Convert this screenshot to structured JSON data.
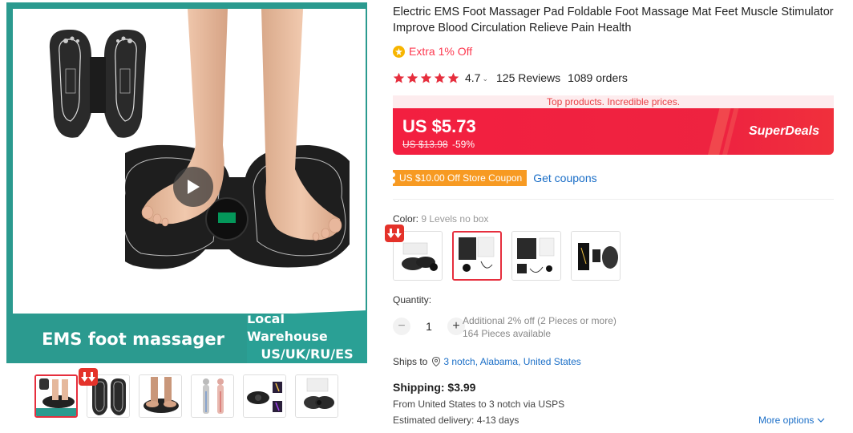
{
  "gallery": {
    "banner_left": "EMS foot massager",
    "banner_right_line1": "Local Warehouse",
    "banner_right_line2": "US/UK/RU/ES",
    "play_icon": "play-icon",
    "thumbnails": [
      {
        "name": "thumb-1",
        "active": true
      },
      {
        "name": "thumb-2",
        "active": false
      },
      {
        "name": "thumb-3",
        "active": false
      },
      {
        "name": "thumb-4",
        "active": false
      },
      {
        "name": "thumb-5",
        "active": false
      },
      {
        "name": "thumb-6",
        "active": false
      }
    ]
  },
  "product": {
    "title": "Electric EMS Foot Massager Pad Foldable Foot Massage Mat Feet Muscle Stimulator Improve Blood Circulation Relieve Pain Health",
    "extra_off": "Extra 1% Off",
    "rating": "4.7",
    "reviews": "125 Reviews",
    "orders": "1089 orders",
    "tagline": "Top products. Incredible prices.",
    "price": "US $5.73",
    "original_price": "US $13.98",
    "discount": "-59%",
    "superdeals": "SuperDeals",
    "coupon": "US $10.00 Off Store Coupon",
    "get_coupons": "Get coupons",
    "color_label": "Color:",
    "color_value": "9 Levels no box",
    "quantity_label": "Quantity:",
    "quantity": "1",
    "qty_minus": "−",
    "qty_plus": "+",
    "additional_off": "Additional 2% off (2 Pieces or more)",
    "pieces_available": "164 Pieces available",
    "ships_to_label": "Ships to",
    "ships_to_location": "3 notch, Alabama, United States",
    "shipping": "Shipping: $3.99",
    "from_line": "From United States to 3 notch via USPS",
    "delivery": "Estimated delivery: 4-13 days",
    "more_options": "More options"
  },
  "colors": {
    "accent": "#e62e3d",
    "price_red": "#f31f40",
    "coupon_orange": "#f79a22",
    "link_blue": "#1a6ec7",
    "teal": "#2b9a8f",
    "star": "#e62e3d"
  }
}
